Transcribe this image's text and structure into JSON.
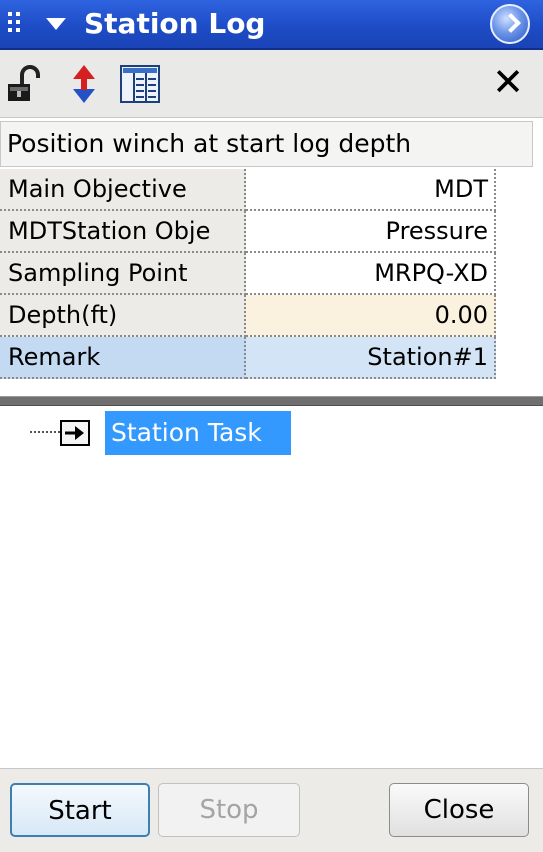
{
  "window": {
    "title": "Station Log"
  },
  "toolbar": {
    "icons": [
      "padlock-icon",
      "sort-arrows-icon",
      "columns-icon"
    ],
    "close_glyph": "✕"
  },
  "status": {
    "text": "Position winch at start log depth"
  },
  "properties": [
    {
      "label": "Main Objective",
      "value": "MDT"
    },
    {
      "label": "MDTStation Obje",
      "value": "Pressure"
    },
    {
      "label": "Sampling Point",
      "value": "MRPQ-XD"
    },
    {
      "label": "Depth(ft)",
      "value": "0.00"
    },
    {
      "label": "Remark",
      "value": "Station#1"
    }
  ],
  "tree": {
    "items": [
      {
        "label": "Station Task",
        "selected": true
      }
    ]
  },
  "buttons": {
    "start": "Start",
    "stop": "Stop",
    "close": "Close"
  },
  "colors": {
    "titlebar": "#1e4cc7",
    "selection": "#3399ff",
    "edit_cell": "#fbf1df"
  }
}
